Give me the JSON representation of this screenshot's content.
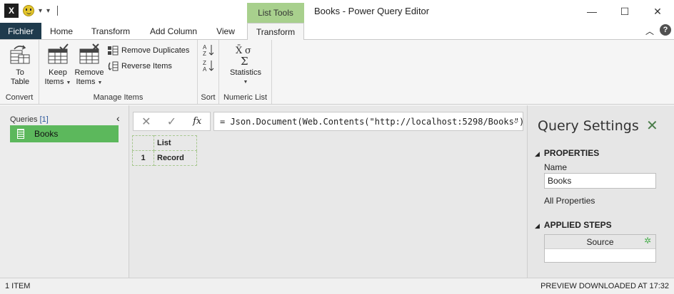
{
  "window": {
    "title": "Books - Power Query Editor",
    "context_tab": "List Tools",
    "controls": {
      "minimize": "—",
      "maximize": "☐",
      "close": "✕"
    }
  },
  "qat": {
    "app_icon": "X",
    "dropdown": "▾",
    "customize": "▾"
  },
  "tabs": [
    {
      "label": "Fichier"
    },
    {
      "label": "Home"
    },
    {
      "label": "Transform"
    },
    {
      "label": "Add Column"
    },
    {
      "label": "View"
    },
    {
      "label": "Transform",
      "active": true
    }
  ],
  "help_label": "?",
  "ribbon": {
    "convert": {
      "group_label": "Convert",
      "to_table": [
        "To",
        "Table"
      ]
    },
    "manage_items": {
      "group_label": "Manage Items",
      "keep_items": [
        "Keep",
        "Items"
      ],
      "remove_items": [
        "Remove",
        "Items"
      ],
      "remove_duplicates": "Remove Duplicates",
      "reverse_items": "Reverse Items"
    },
    "sort": {
      "group_label": "Sort"
    },
    "numeric_list": {
      "group_label": "Numeric List",
      "statistics": "Statistics"
    }
  },
  "queries": {
    "label": "Queries",
    "count": "[1]",
    "items": [
      {
        "name": "Books"
      }
    ]
  },
  "formula": {
    "cancel": "✕",
    "commit": "✓",
    "fx": "fx",
    "text": "= Json.Document(Web.Contents(\"http://localhost:5298/Books\"))"
  },
  "grid": {
    "column_header": "List",
    "rows": [
      {
        "num": "1",
        "value": "Record"
      }
    ]
  },
  "settings": {
    "title": "Query Settings",
    "properties_label": "PROPERTIES",
    "name_label": "Name",
    "name_value": "Books",
    "all_properties": "All Properties",
    "applied_steps_label": "APPLIED STEPS",
    "steps": [
      {
        "name": "Source"
      }
    ]
  },
  "status": {
    "left": "1 ITEM",
    "right": "PREVIEW DOWNLOADED AT 17:32"
  },
  "colors": {
    "accent": "#5cb85c",
    "file_tab": "#1f3b4d",
    "context_tab": "#a8d08d"
  }
}
